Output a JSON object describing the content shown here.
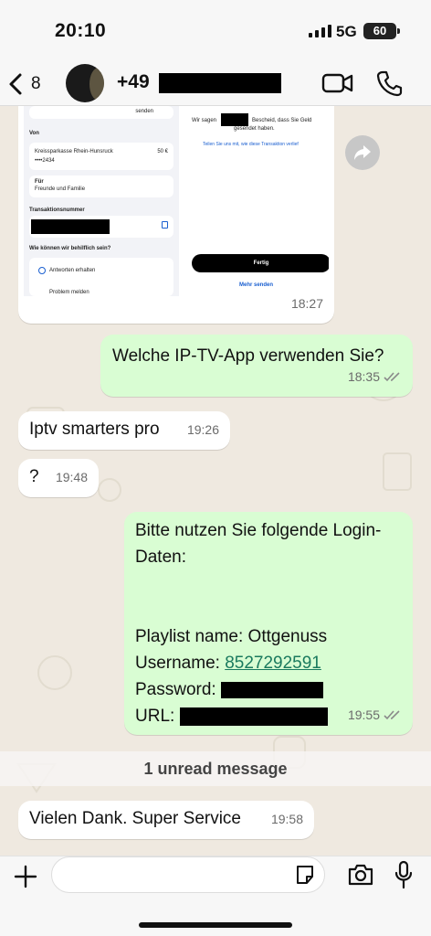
{
  "status_bar": {
    "time": "20:10",
    "network": "5G",
    "battery": "60"
  },
  "header": {
    "back_count": "8",
    "contact_prefix": "+49"
  },
  "image_message": {
    "time": "18:27",
    "left_panel": {
      "sender_label": "senden",
      "von_label": "Von",
      "bank_name": "Kreissparkasse Rhein-Hunsruck",
      "amount": "50 €",
      "account_mask": "••••2434",
      "fur_label": "Für",
      "fur_value": "Freunde und Familie",
      "transaction_label": "Transaktionsnummer",
      "help_label": "Wie können wir behilflich sein?",
      "help_item_1": "Antworten erhalten",
      "help_item_2": "Problem melden"
    },
    "right_panel": {
      "thanks_text_a": "Wir sagen",
      "thanks_text_b": "Bescheid, dass Sie Geld",
      "thanks_text_c": "gesendet haben.",
      "share_link": "Teilen Sie uns mit, wie diese Transaktion verlief",
      "done_button": "Fertig",
      "send_more": "Mehr senden"
    }
  },
  "messages": [
    {
      "direction": "out",
      "text": "Welche IP-TV-App verwenden Sie?",
      "time": "18:35"
    },
    {
      "direction": "in",
      "text": "Iptv smarters pro",
      "time": "19:26"
    },
    {
      "direction": "in",
      "text": "?",
      "time": "19:48"
    },
    {
      "direction": "out",
      "line1": "Bitte nutzen Sie folgende Login-",
      "line2": "Daten:",
      "playlist": "Playlist name: Ottgenuss",
      "username_label": "Username:",
      "username_value": "8527292591",
      "password_label": "Password:",
      "url_label": "URL:",
      "time": "19:55"
    },
    {
      "direction": "in",
      "text": "Vielen Dank. Super Service",
      "time": "19:58"
    }
  ],
  "unread_banner": "1 unread message",
  "icons": [
    "back-chevron-icon",
    "video-call-icon",
    "phone-icon",
    "share-icon",
    "plus-icon",
    "sticker-icon",
    "camera-icon",
    "mic-icon",
    "double-check-icon"
  ]
}
